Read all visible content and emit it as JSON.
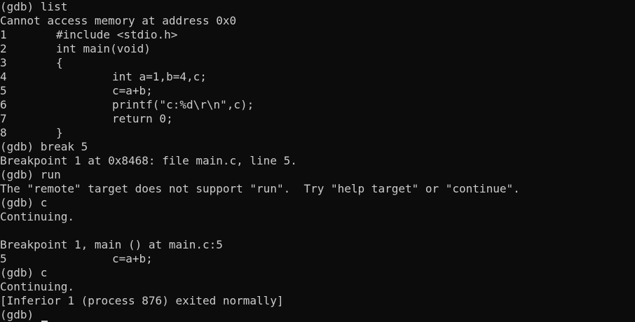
{
  "terminal": {
    "background": "#0c0c0c",
    "foreground": "#cccccc",
    "lines": [
      {
        "type": "plain",
        "text": "(gdb) list"
      },
      {
        "type": "plain",
        "text": "Cannot access memory at address 0x0"
      },
      {
        "type": "source",
        "no": "1",
        "indent": 1,
        "text": "#include <stdio.h>"
      },
      {
        "type": "source",
        "no": "2",
        "indent": 1,
        "text": "int main(void)"
      },
      {
        "type": "source",
        "no": "3",
        "indent": 1,
        "text": "{"
      },
      {
        "type": "source",
        "no": "4",
        "indent": 2,
        "text": "int a=1,b=4,c;"
      },
      {
        "type": "source",
        "no": "5",
        "indent": 2,
        "text": "c=a+b;"
      },
      {
        "type": "source",
        "no": "6",
        "indent": 2,
        "text": "printf(\"c:%d\\r\\n\",c);"
      },
      {
        "type": "source",
        "no": "7",
        "indent": 2,
        "text": "return 0;"
      },
      {
        "type": "source",
        "no": "8",
        "indent": 1,
        "text": "}"
      },
      {
        "type": "plain",
        "text": "(gdb) break 5"
      },
      {
        "type": "plain",
        "text": "Breakpoint 1 at 0x8468: file main.c, line 5."
      },
      {
        "type": "plain",
        "text": "(gdb) run"
      },
      {
        "type": "plain",
        "text": "The \"remote\" target does not support \"run\".  Try \"help target\" or \"continue\"."
      },
      {
        "type": "plain",
        "text": "(gdb) c"
      },
      {
        "type": "plain",
        "text": "Continuing."
      },
      {
        "type": "plain",
        "text": ""
      },
      {
        "type": "plain",
        "text": "Breakpoint 1, main () at main.c:5"
      },
      {
        "type": "source",
        "no": "5",
        "indent": 2,
        "text": "c=a+b;"
      },
      {
        "type": "plain",
        "text": "(gdb) c"
      },
      {
        "type": "plain",
        "text": "Continuing."
      },
      {
        "type": "plain",
        "text": "[Inferior 1 (process 876) exited normally]"
      },
      {
        "type": "prompt",
        "text": "(gdb) "
      }
    ]
  }
}
